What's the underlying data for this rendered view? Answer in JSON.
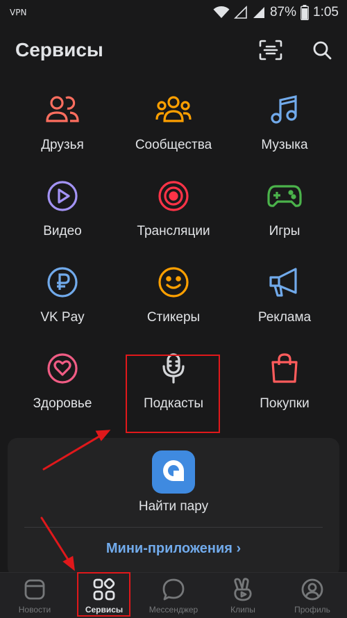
{
  "status_bar": {
    "vpn": "VPN",
    "battery": "87%",
    "time": "1:05"
  },
  "header": {
    "title": "Сервисы",
    "qr_icon": "qr-scan-icon",
    "search_icon": "search-icon"
  },
  "services": [
    {
      "label": "Друзья",
      "icon": "friends-icon",
      "color": "#ff6e5f"
    },
    {
      "label": "Сообщества",
      "icon": "communities-icon",
      "color": "#ffa000"
    },
    {
      "label": "Музыка",
      "icon": "music-icon",
      "color": "#71aaeb"
    },
    {
      "label": "Видео",
      "icon": "video-icon",
      "color": "#a393f5"
    },
    {
      "label": "Трансляции",
      "icon": "live-icon",
      "color": "#ff3347"
    },
    {
      "label": "Игры",
      "icon": "games-icon",
      "color": "#4bb34b"
    },
    {
      "label": "VK Pay",
      "icon": "vkpay-icon",
      "color": "#71aaeb"
    },
    {
      "label": "Стикеры",
      "icon": "stickers-icon",
      "color": "#ffa000"
    },
    {
      "label": "Реклама",
      "icon": "ads-icon",
      "color": "#71aaeb"
    },
    {
      "label": "Здоровье",
      "icon": "health-icon",
      "color": "#f05c84"
    },
    {
      "label": "Подкасты",
      "icon": "podcasts-icon",
      "color": "#d3d5d8"
    },
    {
      "label": "Покупки",
      "icon": "shopping-icon",
      "color": "#ff5c5c"
    }
  ],
  "card": {
    "app_label": "Найти пару",
    "app_icon": "dating-app-icon",
    "mini_apps": "Мини-приложения ›"
  },
  "tabbar": [
    {
      "label": "Новости",
      "icon": "news-icon",
      "active": false
    },
    {
      "label": "Сервисы",
      "icon": "services-icon",
      "active": true
    },
    {
      "label": "Мессенджер",
      "icon": "messenger-icon",
      "active": false
    },
    {
      "label": "Клипы",
      "icon": "clips-icon",
      "active": false
    },
    {
      "label": "Профиль",
      "icon": "profile-icon",
      "active": false
    }
  ],
  "colors": {
    "accent": "#71aaeb",
    "annotation": "#e0181b",
    "background": "#19191a"
  }
}
